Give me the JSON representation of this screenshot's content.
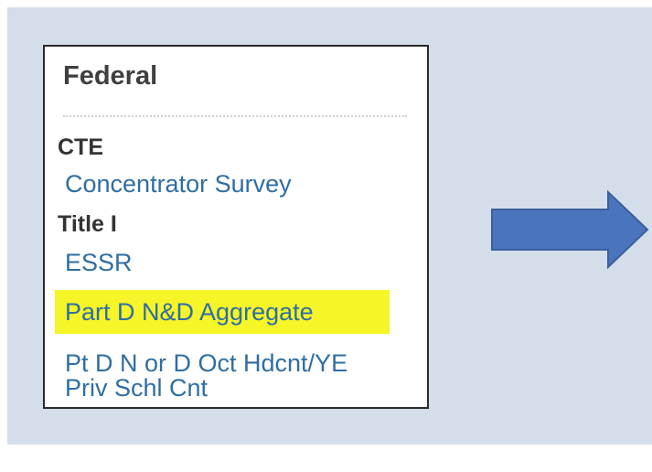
{
  "menu": {
    "title": "Federal",
    "sections": [
      {
        "header": "CTE",
        "items": [
          "Concentrator Survey"
        ]
      },
      {
        "header": "Title I",
        "items": [
          "ESSR",
          "Part D N&D Aggregate",
          "Pt D N or D Oct Hdcnt/YE",
          "Priv Schl Cnt"
        ]
      }
    ],
    "highlighted_item": "Part D N&D Aggregate"
  },
  "colors": {
    "background": "#d4deea",
    "link": "#2f6ea3",
    "highlight": "#f5f527",
    "arrow": "#4a75be",
    "arrow_border": "#3a5f9d"
  },
  "icons": {
    "arrow": "right-arrow-icon"
  }
}
